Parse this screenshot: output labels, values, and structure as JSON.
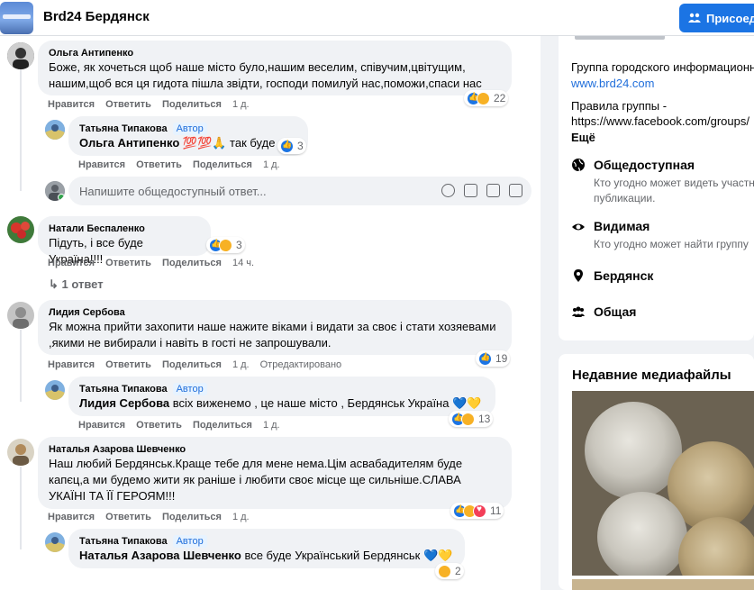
{
  "header": {
    "group_name": "Brd24 Бердянск",
    "join_label": "Присоед"
  },
  "comments": [
    {
      "author": "Ольга Антипенко",
      "text": "Боже, як хочеться щоб наше місто було,нашим веселим, співучим,цвітущим, нашим,щоб вся ця гидота пішла звідти, господи помилуй нас,поможи,спаси нас",
      "reactions": "22",
      "actions": {
        "like": "Нравится",
        "reply": "Ответить",
        "share": "Поделиться",
        "time": "1 д."
      },
      "reply": {
        "author": "Татьяна Типакова",
        "badge": "Автор",
        "mention": "Ольга Антипенко",
        "text": "💯💯🙏 так буде",
        "reactions": "3",
        "actions": {
          "like": "Нравится",
          "reply": "Ответить",
          "share": "Поделиться",
          "time": "1 д."
        }
      }
    },
    {
      "author": "Натали Беспаленко",
      "text": "Підуть, і все буде Україна!!!!",
      "reactions": "3",
      "actions": {
        "like": "Нравится",
        "reply": "Ответить",
        "share": "Поделиться",
        "time": "14 ч."
      },
      "replies_link": "1 ответ"
    },
    {
      "author": "Лидия Сербова",
      "text": "Як можна прийти захопити наше нажите віками і видати за своє і стати хозяевами ,якими не вибирали і навіть в гості не запрошували.",
      "reactions": "19",
      "actions": {
        "like": "Нравится",
        "reply": "Ответить",
        "share": "Поделиться",
        "time": "1 д.",
        "edited": "Отредактировано"
      },
      "reply": {
        "author": "Татьяна Типакова",
        "badge": "Автор",
        "mention": "Лидия Сербова",
        "text": "всіх виженемо , це наше місто , Бердянськ Україна 💙💛",
        "reactions": "13",
        "actions": {
          "like": "Нравится",
          "reply": "Ответить",
          "share": "Поделиться",
          "time": "1 д."
        }
      }
    },
    {
      "author": "Наталья Азарова Шевченко",
      "text": "Наш любий Бердянськ.Краще тебе для мене нема.Цім асвабадителям буде капєц,а ми будемо жити як раніше і любити своє місце ще сильніше.СЛАВА УКАЇНІ ТА ЇЇ ГЕРОЯМ!!!",
      "reactions": "11",
      "actions": {
        "like": "Нравится",
        "reply": "Ответить",
        "share": "Поделиться",
        "time": "1 д."
      },
      "reply": {
        "author": "Татьяна Типакова",
        "badge": "Автор",
        "mention": "Наталья Азарова Шевченко",
        "text": "все буде Український Бердянськ 💙💛",
        "reactions": "2"
      }
    }
  ],
  "reply_box": {
    "placeholder": "Напишите общедоступный ответ..."
  },
  "sidebar": {
    "desc_line": "Группа городского информационного",
    "website": "www.brd24.com",
    "rules_line1": "Правила группы -",
    "rules_line2": "https://www.facebook.com/groups/",
    "more": "Ещё",
    "privacy_title": "Общедоступная",
    "privacy_sub1": "Кто угодно может видеть участников",
    "privacy_sub2": "публикации.",
    "visible_title": "Видимая",
    "visible_sub": "Кто угодно может найти группу",
    "location": "Бердянск",
    "type": "Общая",
    "media_title": "Недавние медиафайлы"
  },
  "colors": {
    "accent": "#1b74e4",
    "link": "#216fdb",
    "page_bg": "#f0f2f5"
  }
}
